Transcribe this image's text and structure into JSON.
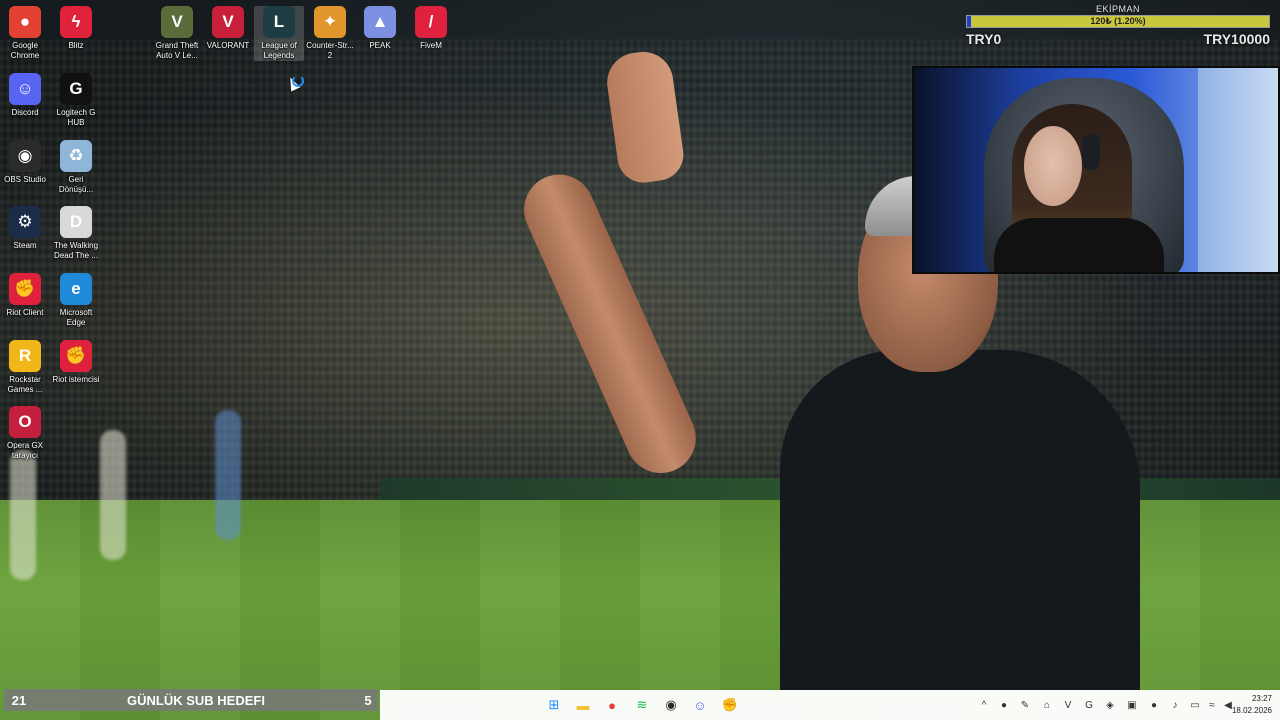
{
  "desktop_icons": [
    {
      "label": "Google\nChrome",
      "icon": "chrome-icon",
      "glyph": "●",
      "color": "#e34133"
    },
    {
      "label": "Blitz",
      "icon": "blitz-icon",
      "glyph": "ϟ",
      "color": "#e0223a"
    },
    {
      "label": "Grand Theft\nAuto V Le...",
      "icon": "gta-icon",
      "glyph": "V",
      "color": "#5b6b3a"
    },
    {
      "label": "VALORANT",
      "icon": "valorant-icon",
      "glyph": "V",
      "color": "#c8203b"
    },
    {
      "label": "League of\nLegends",
      "icon": "league-icon",
      "glyph": "L",
      "color": "#1d3c44"
    },
    {
      "label": "Counter-Str...\n2",
      "icon": "counter-strike-icon",
      "glyph": "✦",
      "color": "#e0962a"
    },
    {
      "label": "PEAK",
      "icon": "peak-icon",
      "glyph": "▲",
      "color": "#7d8fe0"
    },
    {
      "label": "FiveM",
      "icon": "fivem-icon",
      "glyph": "/",
      "color": "#e0213e"
    },
    {
      "label": "Discord",
      "icon": "discord-icon",
      "glyph": "☺",
      "color": "#5865f2"
    },
    {
      "label": "Logitech G\nHUB",
      "icon": "logitech-icon",
      "glyph": "G",
      "color": "#111111"
    },
    {
      "label": "OBS Studio",
      "icon": "obs-icon",
      "glyph": "◉",
      "color": "#2b2b2b"
    },
    {
      "label": "Geri\nDönüşü...",
      "icon": "recycle-bin-icon",
      "glyph": "♻",
      "color": "#8fb6d8"
    },
    {
      "label": "Steam",
      "icon": "steam-icon",
      "glyph": "⚙",
      "color": "#1b2c48"
    },
    {
      "label": "The Walking\nDead The ...",
      "icon": "walking-dead-icon",
      "glyph": "D",
      "color": "#d9d9d9"
    },
    {
      "label": "Riot Client",
      "icon": "riot-client-icon",
      "glyph": "✊",
      "color": "#e0213e"
    },
    {
      "label": "Microsoft\nEdge",
      "icon": "edge-icon",
      "glyph": "e",
      "color": "#1f8ad8"
    },
    {
      "label": "Rockstar\nGames ...",
      "icon": "rockstar-icon",
      "glyph": "R",
      "color": "#f2b619"
    },
    {
      "label": "Riot istemcisi",
      "icon": "riot-istemcisi-icon",
      "glyph": "✊",
      "color": "#e0213e"
    },
    {
      "label": "Opera GX\ntarayıcı",
      "icon": "opera-gx-icon",
      "glyph": "O",
      "color": "#c41f3c"
    }
  ],
  "donation": {
    "title": "EKİPMAN",
    "progress_text": "120₺ (1.20%)",
    "progress_fraction": 0.012,
    "min_label": "TRY0",
    "max_label": "TRY10000",
    "bar_color": "#c9c83c",
    "fill_color": "#1f3fd1"
  },
  "subgoal": {
    "current": "21",
    "title": "GÜNLÜK SUB HEDEFI",
    "target": "5"
  },
  "taskbar": {
    "apps": [
      {
        "name": "start-button",
        "glyph": "⊞",
        "color": "#1e90ff"
      },
      {
        "name": "file-explorer-icon",
        "glyph": "▬",
        "color": "#f2c037"
      },
      {
        "name": "chrome-taskbar-icon",
        "glyph": "●",
        "color": "#e34133"
      },
      {
        "name": "spotify-icon",
        "glyph": "≋",
        "color": "#1db954"
      },
      {
        "name": "obs-taskbar-icon",
        "glyph": "◉",
        "color": "#2b2b2b"
      },
      {
        "name": "discord-taskbar-icon",
        "glyph": "☺",
        "color": "#5865f2"
      },
      {
        "name": "riot-taskbar-icon",
        "glyph": "✊",
        "color": "#e0213e"
      }
    ],
    "tray": [
      {
        "name": "chevron-up-icon",
        "glyph": "^"
      },
      {
        "name": "tray-green-icon",
        "glyph": "●"
      },
      {
        "name": "tray-pen-icon",
        "glyph": "✎"
      },
      {
        "name": "tray-gamepad-icon",
        "glyph": "⌂"
      },
      {
        "name": "tray-valorant-icon",
        "glyph": "V"
      },
      {
        "name": "tray-logitech-icon",
        "glyph": "G"
      },
      {
        "name": "tray-shield-icon",
        "glyph": "◈"
      },
      {
        "name": "tray-nvidia-icon",
        "glyph": "▣"
      },
      {
        "name": "tray-record-icon",
        "glyph": "●"
      },
      {
        "name": "tray-mic-icon",
        "glyph": "♪"
      },
      {
        "name": "tray-network-icon",
        "glyph": "▭"
      },
      {
        "name": "tray-wifi-icon",
        "glyph": "≈"
      },
      {
        "name": "tray-volume-icon",
        "glyph": "◀"
      }
    ],
    "time": "23:27",
    "date": "18.02.2026"
  }
}
